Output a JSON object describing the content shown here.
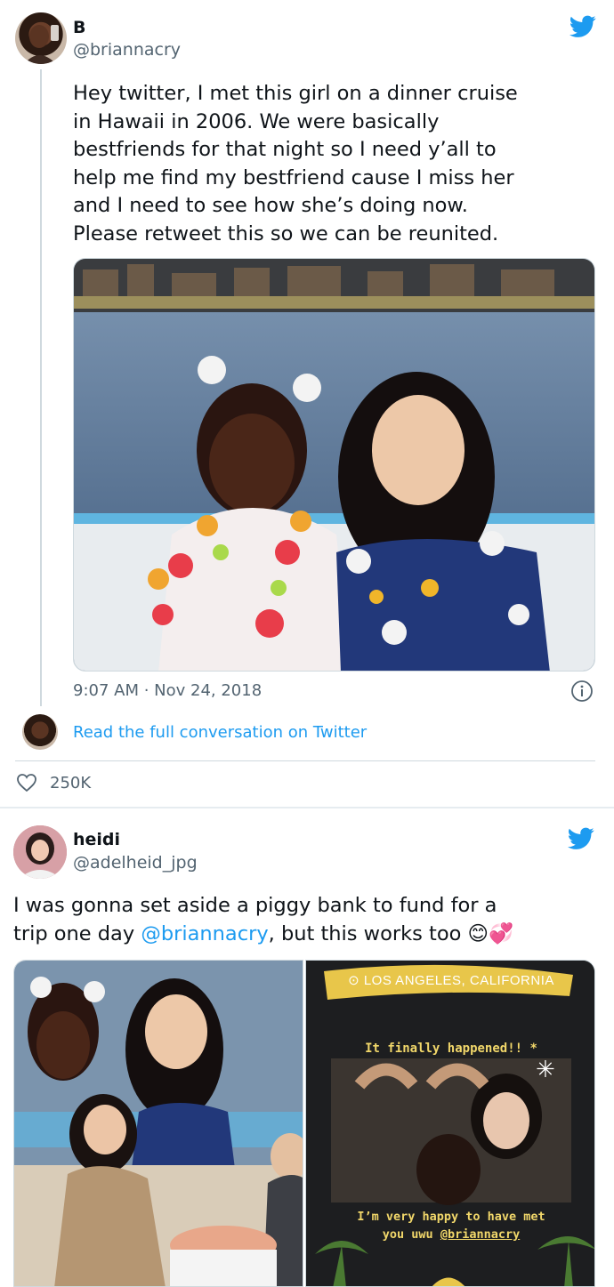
{
  "tweet1": {
    "display_name": "B",
    "handle": "@briannacry",
    "text_lines": [
      "Hey twitter, I met this girl on a dinner cruise",
      "in Hawaii in 2006. We were basically",
      "bestfriends for that night so I need y’all to",
      "help me find my bestfriend cause I miss her",
      "and I need to see how she’s doing now.",
      "Please retweet this so we can be reunited."
    ],
    "timestamp": "9:07 AM · Nov 24, 2018",
    "read_more": "Read the full conversation on Twitter",
    "likes": "250K",
    "icons": {
      "brand": "twitter-bird-icon",
      "info": "info-icon",
      "like": "heart-icon"
    },
    "colors": {
      "brand": "#1d9bf0"
    }
  },
  "tweet2": {
    "display_name": "heidi",
    "handle": "@adelheid_jpg",
    "text_line1": "I was gonna set aside a piggy bank to fund for a",
    "text_line2_prefix": "trip one day ",
    "mention": "@briannacry",
    "text_line2_suffix": ", but this works too",
    "emoji": "😊💞",
    "story": {
      "location": "LOS ANGELES, CALIFORNIA",
      "caption1": "It finally happened!! *",
      "caption2a": "I’m very happy to have met",
      "caption2b_prefix": "you uwu ",
      "caption2b_mention": "@briannacry"
    }
  }
}
